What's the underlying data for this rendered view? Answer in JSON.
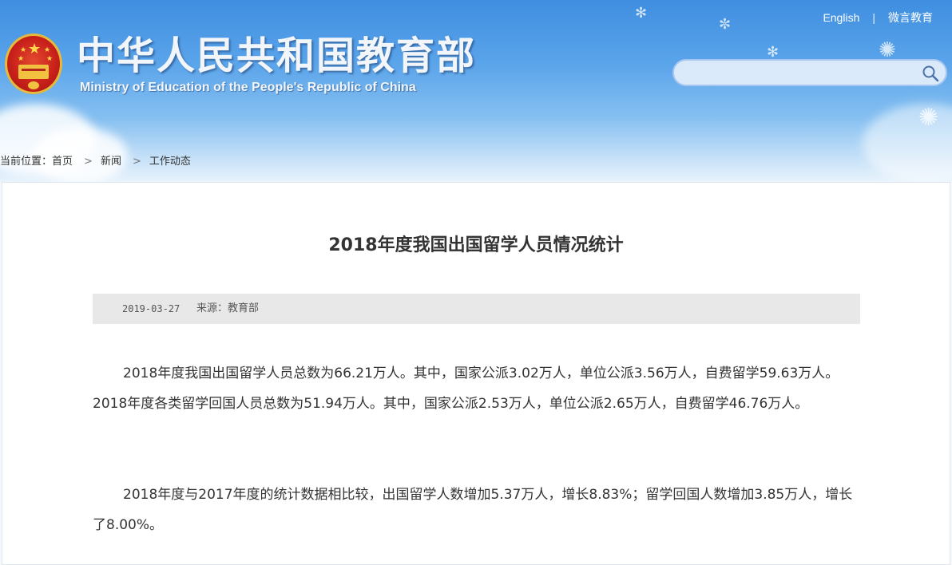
{
  "header": {
    "title_cn": "中华人民共和国教育部",
    "title_en": "Ministry of Education of the People's Republic of China",
    "links": [
      "English",
      "微言教育"
    ],
    "search": {
      "placeholder": "",
      "value": ""
    },
    "colors": {
      "sky_top": "#3f8ee0",
      "sky_bottom": "#e8f3fc",
      "emblem_red": "#c8201a",
      "emblem_gold": "#f0c23f"
    }
  },
  "breadcrumb": {
    "prefix": "当前位置：",
    "items": [
      "首页",
      "新闻",
      "工作动态"
    ]
  },
  "article": {
    "title": "2018年度我国出国留学人员情况统计",
    "date": "2019-03-27",
    "source": "来源：教育部",
    "paragraphs": [
      "2018年度我国出国留学人员总数为66.21万人。其中，国家公派3.02万人，单位公派3.56万人，自费留学59.63万人。2018年度各类留学回国人员总数为51.94万人。其中，国家公派2.53万人，单位公派2.65万人，自费留学46.76万人。",
      "2018年度与2017年度的统计数据相比较，出国留学人数增加5.37万人，增长8.83%；留学回国人数增加3.85万人，增长了8.00%。"
    ]
  },
  "icons": {
    "search": "search-icon",
    "breadcrumb_separator": "chevron-right-icon",
    "emblem": "national-emblem-icon"
  }
}
